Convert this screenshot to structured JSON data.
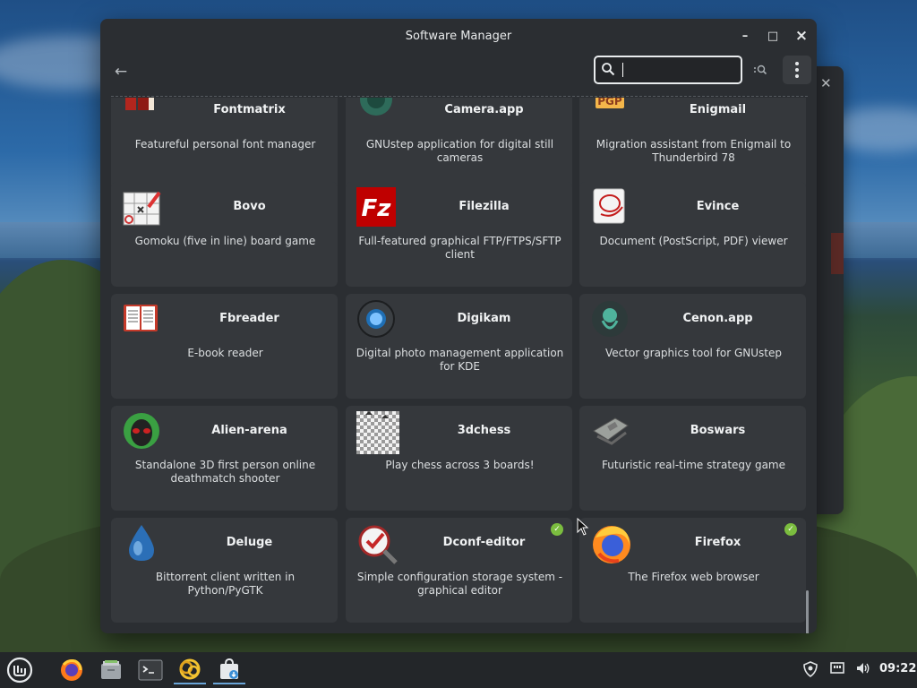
{
  "window": {
    "title": "Software Manager",
    "minimize": "–",
    "maximize": "□",
    "close": "×"
  },
  "toolbar": {
    "back_icon": "arrow-left-icon",
    "search": {
      "value": "",
      "placeholder": ""
    },
    "search_options_icon": "search-options-icon",
    "menu_icon": "kebab-menu-icon"
  },
  "apps": [
    {
      "name": "Fontmatrix",
      "desc": "Featureful personal font manager",
      "icon": "fontmatrix-icon",
      "installed": false
    },
    {
      "name": "Camera.app",
      "desc": "GNUstep application for digital still cameras",
      "icon": "camera-app-icon",
      "installed": false
    },
    {
      "name": "Enigmail",
      "desc": "Migration assistant from Enigmail to Thunderbird 78",
      "icon": "enigmail-icon",
      "installed": false
    },
    {
      "name": "Bovo",
      "desc": "Gomoku (five in line) board game",
      "icon": "bovo-icon",
      "installed": false
    },
    {
      "name": "Filezilla",
      "desc": "Full-featured graphical FTP/FTPS/SFTP client",
      "icon": "filezilla-icon",
      "installed": false
    },
    {
      "name": "Evince",
      "desc": "Document (PostScript, PDF) viewer",
      "icon": "evince-icon",
      "installed": false
    },
    {
      "name": "Fbreader",
      "desc": "E-book reader",
      "icon": "fbreader-icon",
      "installed": false
    },
    {
      "name": "Digikam",
      "desc": "Digital photo management application for KDE",
      "icon": "digikam-icon",
      "installed": false
    },
    {
      "name": "Cenon.app",
      "desc": "Vector graphics tool for GNUstep",
      "icon": "cenon-app-icon",
      "installed": false
    },
    {
      "name": "Alien-arena",
      "desc": "Standalone 3D first person online deathmatch shooter",
      "icon": "alien-arena-icon",
      "installed": false
    },
    {
      "name": "3dchess",
      "desc": "Play chess across 3 boards!",
      "icon": "3dchess-icon",
      "installed": false
    },
    {
      "name": "Boswars",
      "desc": "Futuristic real-time strategy game",
      "icon": "boswars-icon",
      "installed": false
    },
    {
      "name": "Deluge",
      "desc": "Bittorrent client written in Python/PyGTK",
      "icon": "deluge-icon",
      "installed": false
    },
    {
      "name": "Dconf-editor",
      "desc": "Simple configuration storage system - graphical editor",
      "icon": "dconf-editor-icon",
      "installed": true
    },
    {
      "name": "Firefox",
      "desc": "The Firefox web browser",
      "icon": "firefox-icon",
      "installed": true
    }
  ],
  "installed_badge": "✓",
  "taskbar": {
    "menu_icon": "linux-mint-menu-icon",
    "launchers": [
      "firefox-icon",
      "file-manager-icon",
      "terminal-icon",
      "update-manager-icon",
      "software-manager-icon"
    ],
    "tray": [
      "shield-icon",
      "network-icon",
      "volume-icon"
    ],
    "clock": "09:22"
  },
  "colors": {
    "window_bg": "#2b2e32",
    "card_bg": "#35383c",
    "installed_green": "#7bbd3f",
    "taskbar_bg": "#232629"
  }
}
